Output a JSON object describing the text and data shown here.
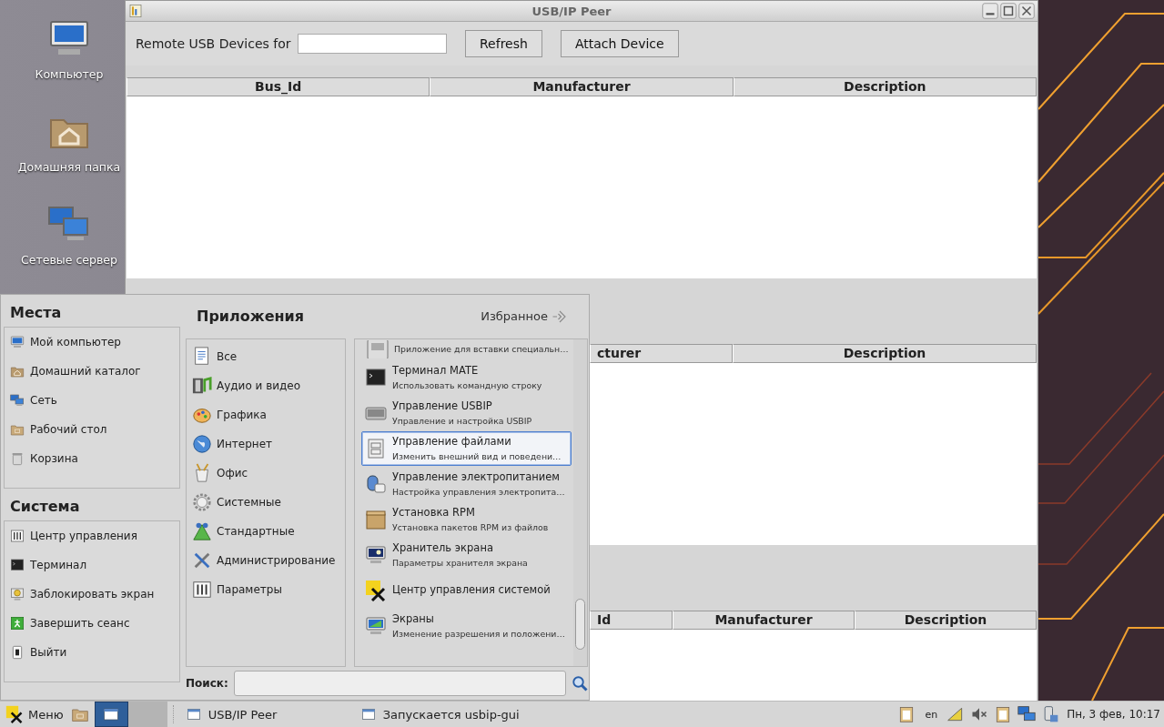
{
  "desktop": {
    "icons": [
      {
        "label": "Компьютер"
      },
      {
        "label": "Домашняя папка"
      },
      {
        "label": "Сетевые сервер"
      }
    ]
  },
  "window": {
    "title": "USB/IP Peer",
    "toolbar": {
      "label": "Remote USB Devices for",
      "buttons": [
        "Refresh",
        "Attach Device"
      ]
    },
    "tables": [
      {
        "columns": [
          "Bus_Id",
          "Manufacturer",
          "Description"
        ]
      },
      {
        "columns": [
          "cturer",
          "Description"
        ]
      },
      {
        "columns": [
          "Id",
          "Manufacturer",
          "Description"
        ]
      }
    ]
  },
  "menu": {
    "places": {
      "title": "Места",
      "items": [
        "Мой компьютер",
        "Домашний каталог",
        "Сеть",
        "Рабочий стол",
        "Корзина"
      ]
    },
    "system": {
      "title": "Система",
      "items": [
        "Центр управления",
        "Терминал",
        "Заблокировать экран",
        "Завершить сеанс",
        "Выйти"
      ]
    },
    "applications": {
      "title": "Приложения",
      "favorites": "Избранное",
      "categories": [
        "Все",
        "Аудио и видео",
        "Графика",
        "Интернет",
        "Офис",
        "Системные",
        "Стандартные",
        "Администрирование",
        "Параметры"
      ],
      "apps": [
        {
          "description": "Приложение для вставки специальн…",
          "selected": false
        },
        {
          "name": "Терминал MATE",
          "description": "Использовать командную строку",
          "selected": false
        },
        {
          "name": "Управление USBIP",
          "description": "Управление и настройка USBIP",
          "selected": false
        },
        {
          "name": "Управление файлами",
          "description": "Изменить внешний вид и поведени…",
          "selected": true
        },
        {
          "name": "Управление электропитанием",
          "description": "Настройка управления электропита…",
          "selected": false
        },
        {
          "name": "Установка RPM",
          "description": "Установка пакетов RPM из файлов",
          "selected": false
        },
        {
          "name": "Хранитель экрана",
          "description": "Параметры хранителя экрана",
          "selected": false
        },
        {
          "name": "Центр управления системой",
          "selected": false
        },
        {
          "name": "Экраны",
          "description": "Изменение разрешения и положени…",
          "selected": false
        }
      ],
      "search": {
        "label": "Поиск:"
      }
    }
  },
  "taskbar": {
    "menu_label": "Меню",
    "tasks": [
      {
        "label": "USB/IP Peer"
      },
      {
        "label": "Запускается usbip-gui"
      }
    ],
    "keyboard_layout": "en",
    "clock": "Пн, 3 фев, 10:17"
  }
}
